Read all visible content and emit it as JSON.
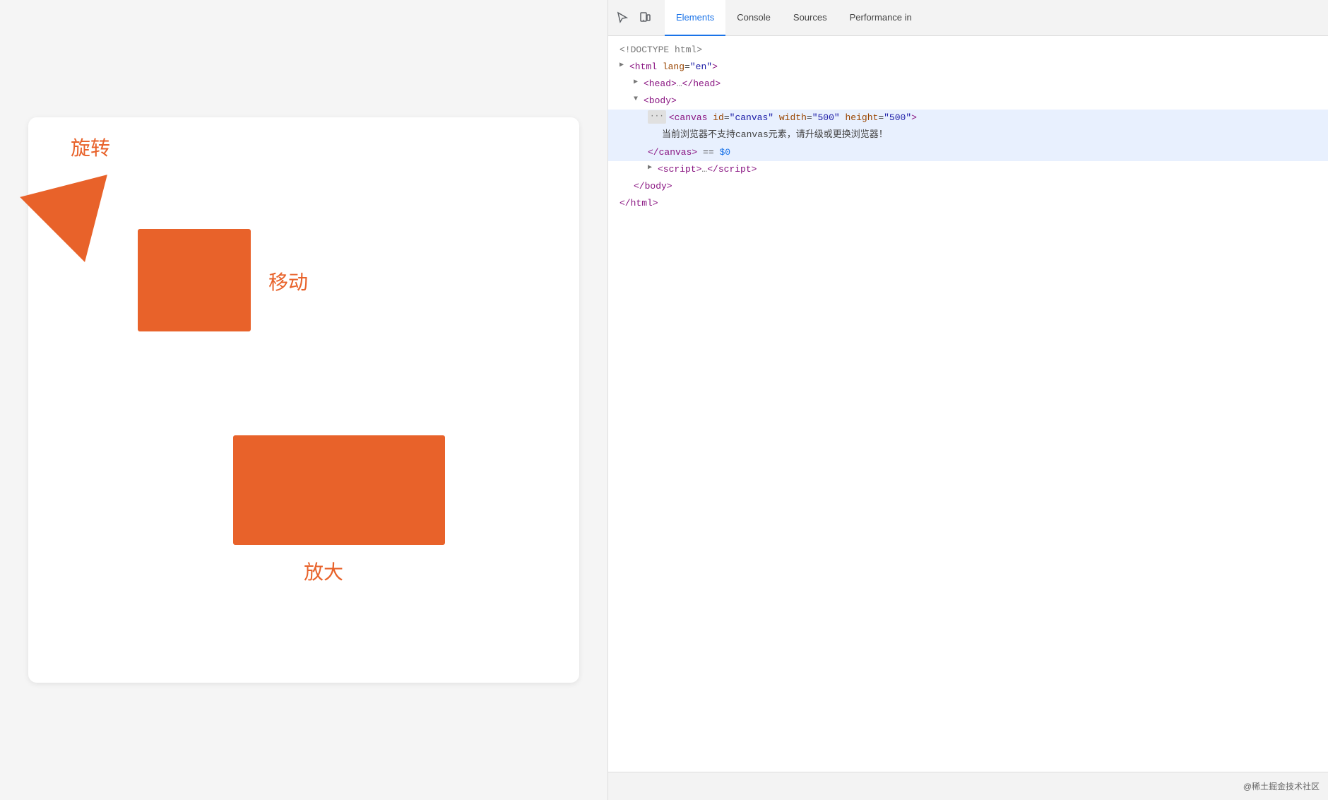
{
  "left": {
    "shapes": {
      "rotate_label": "旋转",
      "move_label": "移动",
      "scale_label": "放大"
    }
  },
  "devtools": {
    "tabs": [
      {
        "id": "elements",
        "label": "Elements",
        "active": true
      },
      {
        "id": "console",
        "label": "Console",
        "active": false
      },
      {
        "id": "sources",
        "label": "Sources",
        "active": false
      },
      {
        "id": "performance",
        "label": "Performance in",
        "active": false
      }
    ],
    "dom": {
      "lines": [
        {
          "indent": 0,
          "content_type": "doctype",
          "text": "<!DOCTYPE html>"
        },
        {
          "indent": 0,
          "content_type": "tag-open",
          "tag": "html",
          "attrs": [
            {
              "name": "lang",
              "value": "\"en\""
            }
          ],
          "has_children": true
        },
        {
          "indent": 1,
          "content_type": "tag-collapsed",
          "tag": "head",
          "collapsed": true
        },
        {
          "indent": 1,
          "content_type": "tag-open",
          "tag": "body",
          "has_children": true,
          "expanded": true
        },
        {
          "indent": 2,
          "content_type": "tag-selected",
          "tag": "canvas",
          "attrs": [
            {
              "name": "id",
              "value": "\"canvas\""
            },
            {
              "name": "width",
              "value": "\"500\""
            },
            {
              "name": "height",
              "value": "\"500\""
            }
          ]
        },
        {
          "indent": 3,
          "content_type": "text",
          "text": "当前浏览器不支持canvas元素，请升级或更换浏览器！"
        },
        {
          "indent": 2,
          "content_type": "tag-close-selected",
          "tag": "canvas",
          "equals_dollar": true
        },
        {
          "indent": 2,
          "content_type": "tag-collapsed",
          "tag": "script",
          "collapsed": true
        },
        {
          "indent": 1,
          "content_type": "tag-close",
          "tag": "body"
        },
        {
          "indent": 0,
          "content_type": "tag-close",
          "tag": "html"
        }
      ]
    }
  },
  "watermark": "@稀土掘金技术社区"
}
